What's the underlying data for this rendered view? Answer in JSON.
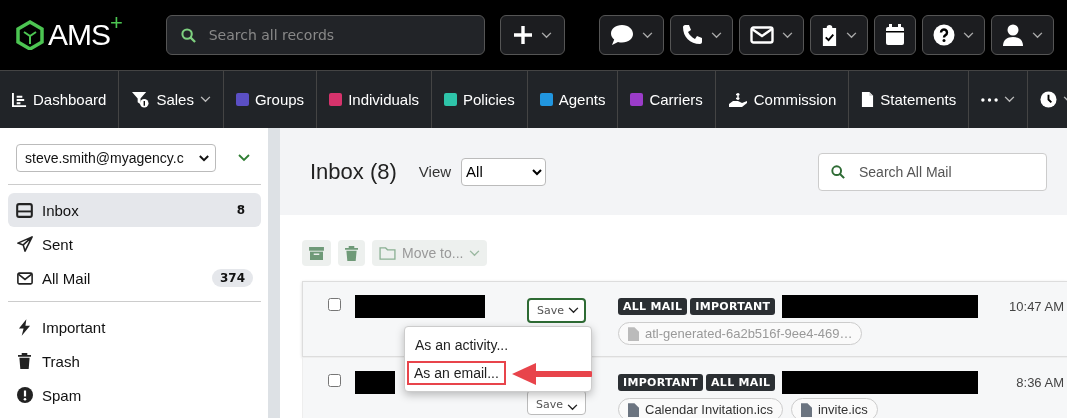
{
  "logo": {
    "text": "AMS",
    "plus": "+"
  },
  "search": {
    "placeholder": "Search all records"
  },
  "toolbar": [
    {
      "kind": "add",
      "dropdown": true
    },
    {
      "kind": "chat",
      "dropdown": true
    },
    {
      "kind": "phone",
      "dropdown": true
    },
    {
      "kind": "mail",
      "dropdown": true
    },
    {
      "kind": "tasks",
      "dropdown": true
    },
    {
      "kind": "calendar",
      "dropdown": false
    },
    {
      "kind": "help",
      "dropdown": true
    },
    {
      "kind": "user",
      "dropdown": true
    }
  ],
  "nav": [
    {
      "label": "Dashboard",
      "kind": "chart",
      "dropdown": false
    },
    {
      "label": "Sales",
      "kind": "funnel",
      "dropdown": true
    },
    {
      "label": "Groups",
      "kind": "swatch",
      "color": "#5b4fc4",
      "dropdown": false
    },
    {
      "label": "Individuals",
      "kind": "swatch",
      "color": "#d6336c",
      "dropdown": false
    },
    {
      "label": "Policies",
      "kind": "swatch",
      "color": "#2ec4a9",
      "dropdown": false
    },
    {
      "label": "Agents",
      "kind": "swatch",
      "color": "#2196e0",
      "dropdown": false
    },
    {
      "label": "Carriers",
      "kind": "swatch",
      "color": "#9b3cc9",
      "dropdown": false
    },
    {
      "label": "Commission",
      "kind": "hand",
      "dropdown": false
    },
    {
      "label": "Statements",
      "kind": "file",
      "dropdown": false
    },
    {
      "kind": "more",
      "dropdown": true
    },
    {
      "kind": "clock",
      "dropdown": true
    }
  ],
  "sidebar": {
    "account": "steve.smith@myagency.c",
    "groups": [
      [
        {
          "label": "Inbox",
          "kind": "inbox",
          "count": "8",
          "selected": true
        },
        {
          "label": "Sent",
          "kind": "send",
          "selected": false
        },
        {
          "label": "All Mail",
          "kind": "mail",
          "count": "374",
          "selected": false
        }
      ],
      [
        {
          "label": "Important",
          "kind": "bolt",
          "selected": false
        },
        {
          "label": "Trash",
          "kind": "trash",
          "selected": false
        },
        {
          "label": "Spam",
          "kind": "alert",
          "selected": false
        }
      ]
    ]
  },
  "main": {
    "title": "Inbox (8)",
    "view_label": "View",
    "view_value": "All",
    "search_placeholder": "Search All Mail",
    "move_to": {
      "label": "Move to...",
      "disabled": true
    },
    "messages": [
      {
        "checked": false,
        "selected": true,
        "save": "Save",
        "tags": [
          "ALL MAIL",
          "IMPORTANT"
        ],
        "attachments": [
          "atl-generated-6a2b516f-9ee4-469…"
        ],
        "time": "10:47 AM"
      },
      {
        "checked": false,
        "selected": false,
        "save": "Save",
        "tags": [
          "IMPORTANT",
          "ALL MAIL"
        ],
        "attachments": [
          "Calendar Invitation.ics",
          "invite.ics"
        ],
        "time": "8:36 AM"
      }
    ],
    "save_menu": [
      {
        "label": "As an activity...",
        "highlighted": false
      },
      {
        "label": "As an email...",
        "highlighted": true
      }
    ]
  }
}
